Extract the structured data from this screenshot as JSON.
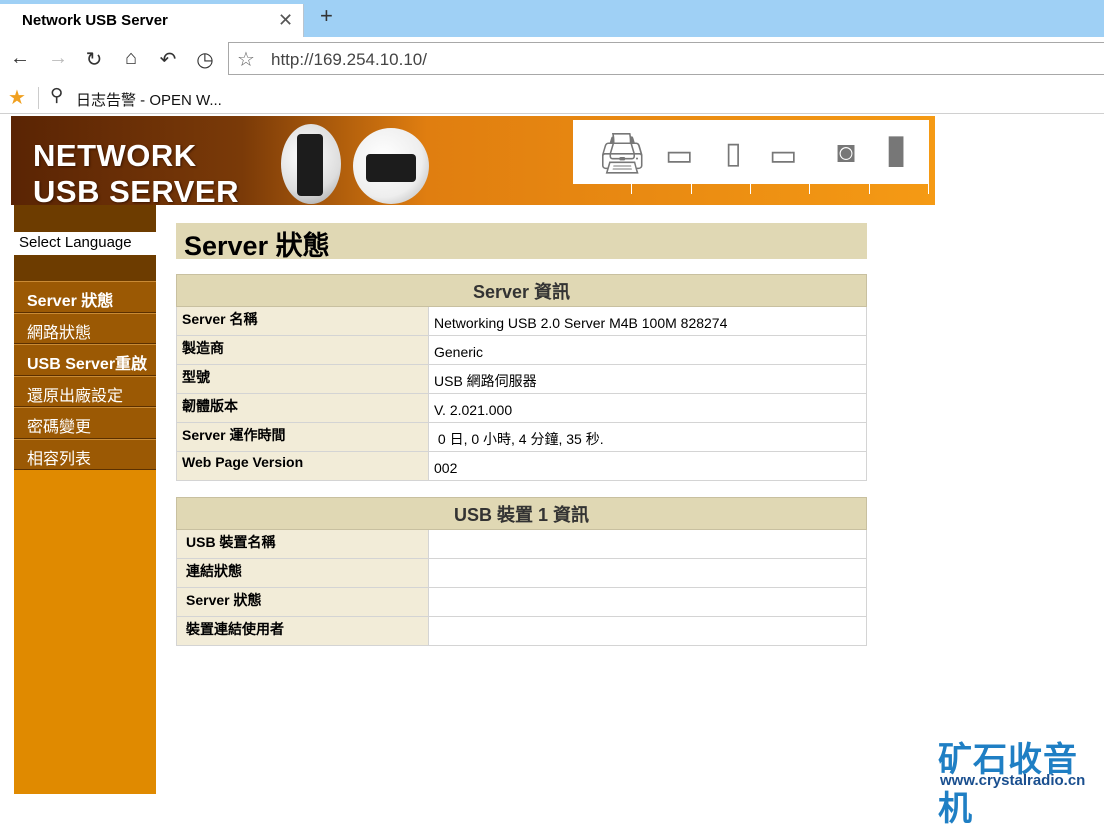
{
  "browser": {
    "tab_title": "Network USB Server",
    "tab_close": "✕",
    "new_tab": "+",
    "url": "http://169.254.10.10/",
    "bookmark_label": "日志告警 - OPEN W..."
  },
  "banner": {
    "line1": "NETWORK",
    "line2": "USB SERVER"
  },
  "sidebar": {
    "language_label": "Select Language",
    "menu": [
      {
        "label": "Server 狀態",
        "active": true
      },
      {
        "label": "網路狀態"
      },
      {
        "label": "USB Server重啟"
      },
      {
        "label": "還原出廠設定"
      },
      {
        "label": "密碼變更"
      },
      {
        "label": "相容列表"
      }
    ]
  },
  "page": {
    "title": "Server 狀態"
  },
  "server_info": {
    "header": "Server 資訊",
    "rows": [
      {
        "label": "Server 名稱",
        "value": "Networking USB 2.0 Server M4B 100M 828274"
      },
      {
        "label": "製造商",
        "value": "Generic"
      },
      {
        "label": "型號",
        "value": "USB 網路伺服器"
      },
      {
        "label": "韌體版本",
        "value": "V. 2.021.000"
      },
      {
        "label": "Server 運作時間",
        "value": " 0 日, 0 小時, 4 分鐘, 35 秒."
      },
      {
        "label": "Web Page Version",
        "value": "002"
      }
    ]
  },
  "usb_info": {
    "header": "USB 裝置 1 資訊",
    "rows": [
      {
        "label": "USB 裝置名稱",
        "value": ""
      },
      {
        "label": "連結狀態",
        "value": ""
      },
      {
        "label": "Server 狀態",
        "value": ""
      },
      {
        "label": "裝置連結使用者",
        "value": ""
      }
    ]
  },
  "watermark": {
    "cn": "矿石收音机",
    "url": "www.crystalradio.cn"
  }
}
